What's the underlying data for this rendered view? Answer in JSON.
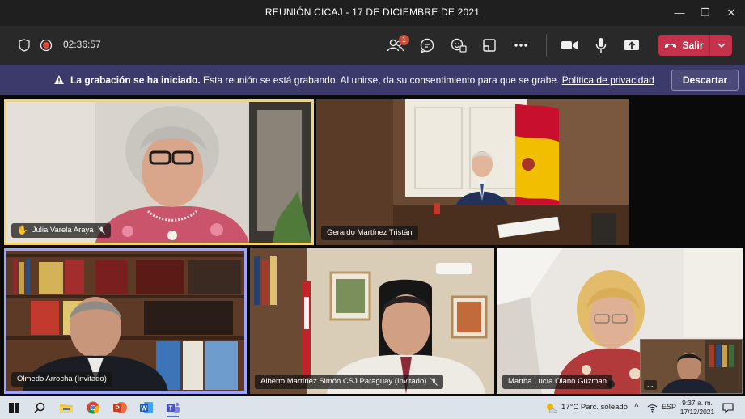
{
  "window": {
    "title": "REUNIÓN CICAJ - 17 DE DICIEMBRE DE 2021"
  },
  "toolbar": {
    "timer": "02:36:57",
    "participants_badge": "1",
    "leave_label": "Salir"
  },
  "banner": {
    "title": "La grabación se ha iniciado.",
    "text": "Esta reunión se está grabando. Al unirse, da su consentimiento para que se grabe.",
    "link": "Política de privacidad",
    "dismiss_label": "Descartar"
  },
  "participants": [
    {
      "name": "Julia Varela Araya",
      "hand_raised": true,
      "muted": true
    },
    {
      "name": "Gerardo Martínez Tristán",
      "hand_raised": false,
      "muted": false
    },
    {
      "name": "Olmedo Arrocha (Invitado)",
      "hand_raised": false,
      "muted": false
    },
    {
      "name": "Alberto Martínez Simón CSJ Paraguay (Invitado)",
      "hand_raised": false,
      "muted": true
    },
    {
      "name": "Martha Lucía Olano Guzman",
      "hand_raised": false,
      "muted": false
    }
  ],
  "self_view": {
    "more_label": "..."
  },
  "taskbar": {
    "weather": "17°C  Parc. soleado",
    "language": "ESP",
    "time": "9:37 a. m.",
    "date": "17/12/2021"
  },
  "colors": {
    "leave": "#c4314b",
    "banner": "#3b3a6b",
    "active_speaker": "#f5d36a",
    "selected": "#9ea2ff"
  }
}
